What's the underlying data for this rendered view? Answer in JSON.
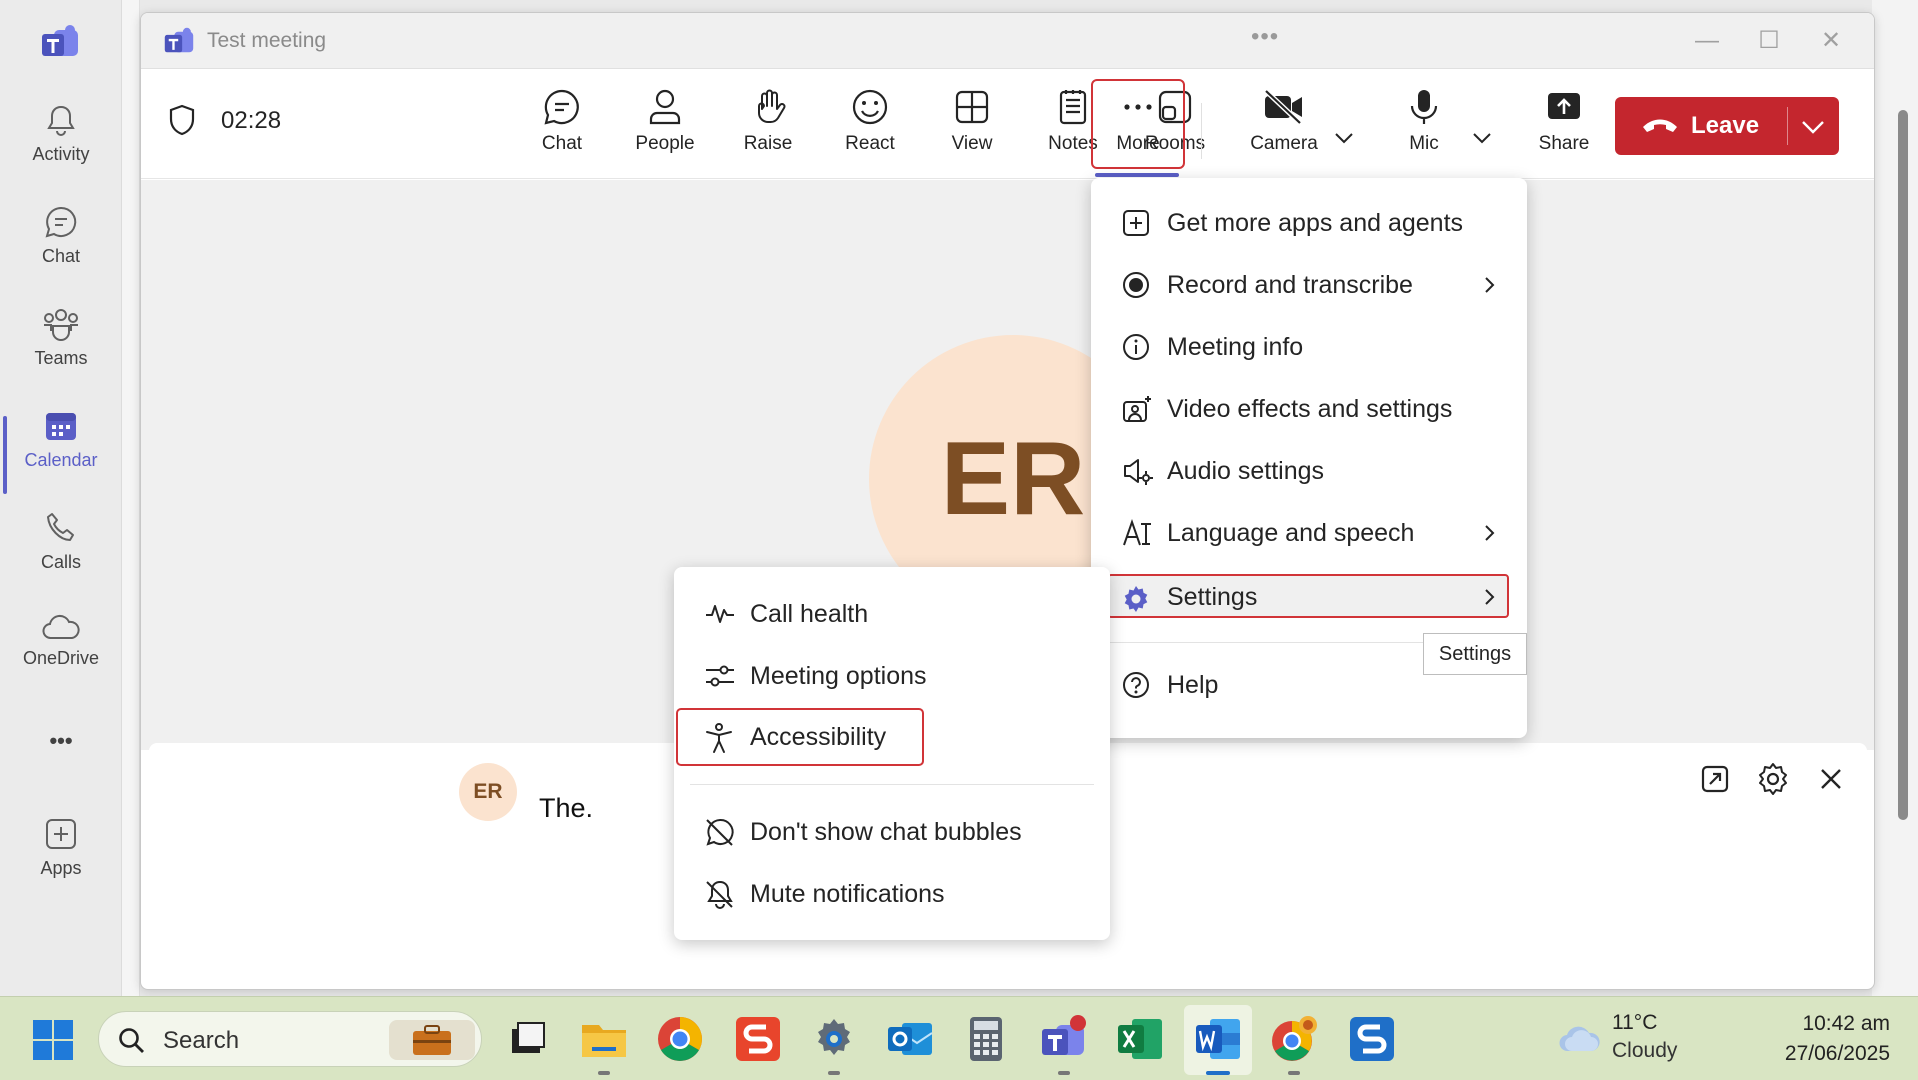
{
  "rail": {
    "items": [
      {
        "label": "Activity",
        "icon": "bell-icon"
      },
      {
        "label": "Chat",
        "icon": "chat-icon"
      },
      {
        "label": "Teams",
        "icon": "teams-icon"
      },
      {
        "label": "Calendar",
        "icon": "calendar-icon",
        "active": true
      },
      {
        "label": "Calls",
        "icon": "phone-icon"
      },
      {
        "label": "OneDrive",
        "icon": "cloud-icon"
      },
      {
        "label": "•••",
        "icon": "more-icon"
      },
      {
        "label": "Apps",
        "icon": "add-apps-icon"
      }
    ]
  },
  "window": {
    "title": "Test meeting",
    "drag_dots": "•••",
    "minimize": "—",
    "maximize": "☐",
    "close": "✕"
  },
  "toolbar": {
    "timer": "02:28",
    "buttons": [
      {
        "label": "Chat"
      },
      {
        "label": "People"
      },
      {
        "label": "Raise"
      },
      {
        "label": "React"
      },
      {
        "label": "View"
      },
      {
        "label": "Notes"
      },
      {
        "label": "Rooms"
      },
      {
        "label": "More"
      },
      {
        "label": "Camera"
      },
      {
        "label": "Mic"
      },
      {
        "label": "Share"
      }
    ],
    "leave_label": "Leave"
  },
  "stage": {
    "avatar_initials": "ER"
  },
  "captions": {
    "speaker_initials": "ER",
    "text": "The."
  },
  "more_menu": {
    "items": [
      {
        "label": "Get more apps and agents",
        "icon": "add-square-icon"
      },
      {
        "label": "Record and transcribe",
        "icon": "record-icon",
        "submenu": true
      },
      {
        "label": "Meeting info",
        "icon": "info-icon"
      },
      {
        "label": "Video effects and settings",
        "icon": "video-effects-icon"
      },
      {
        "label": "Audio settings",
        "icon": "speaker-settings-icon"
      },
      {
        "label": "Language and speech",
        "icon": "language-icon",
        "submenu": true
      },
      {
        "label": "Settings",
        "icon": "gear-icon",
        "submenu": true,
        "highlighted": true
      },
      {
        "label": "Help",
        "icon": "help-icon"
      }
    ],
    "tooltip": "Settings"
  },
  "settings_submenu": {
    "items": [
      {
        "label": "Call health",
        "icon": "pulse-icon"
      },
      {
        "label": "Meeting options",
        "icon": "sliders-icon"
      },
      {
        "label": "Accessibility",
        "icon": "accessibility-icon",
        "highlighted": true
      },
      {
        "label": "Don't show chat bubbles",
        "icon": "chat-off-icon"
      },
      {
        "label": "Mute notifications",
        "icon": "bell-off-icon"
      }
    ]
  },
  "taskbar": {
    "search_placeholder": "Search",
    "weather_temp": "11°C",
    "weather_cond": "Cloudy",
    "time": "10:42 am",
    "date": "27/06/2025"
  },
  "colors": {
    "accent": "#5b5fc7",
    "leave": "#c4262e",
    "highlight_border": "#d13438"
  }
}
